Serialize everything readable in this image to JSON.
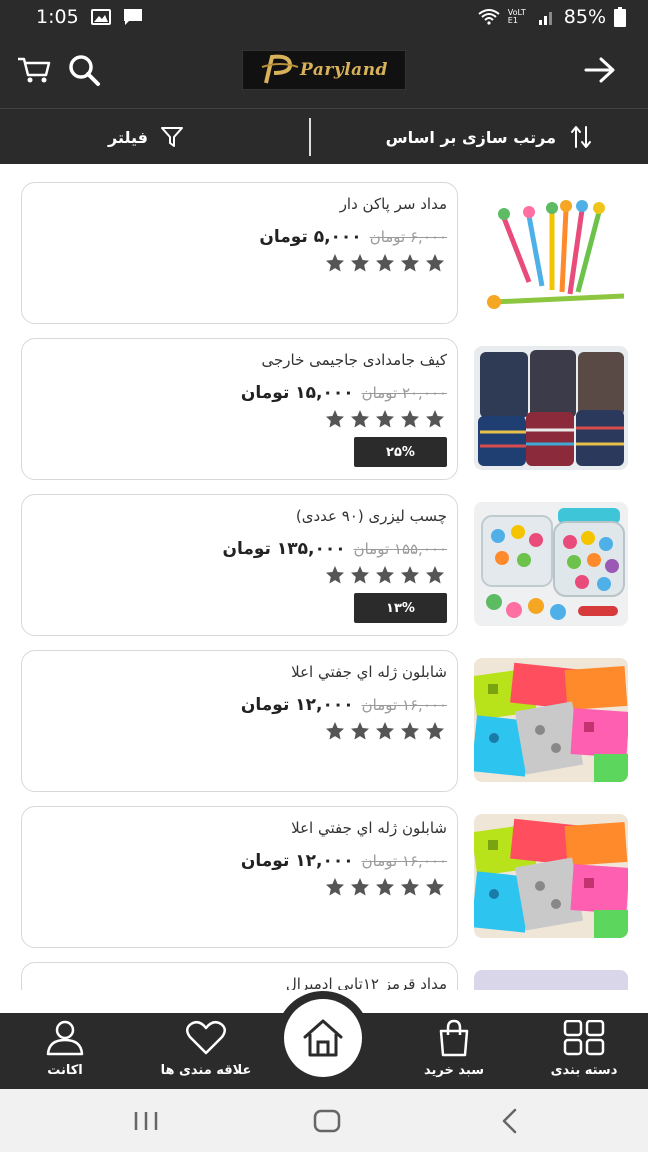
{
  "status_bar": {
    "time": "1:05",
    "network": "VoLTE1",
    "battery": "85%",
    "icons": [
      "image-icon",
      "message-icon",
      "wifi-icon",
      "signal-icon",
      "battery-icon"
    ]
  },
  "header": {
    "logo_text": "Paryland",
    "icons": [
      "cart-icon",
      "search-icon",
      "arrow-right-icon"
    ]
  },
  "toolbar": {
    "sort_label": "مرتب سازی بر اساس",
    "filter_label": "فیلتر",
    "icons": [
      "sort-icon",
      "filter-icon"
    ]
  },
  "products": [
    {
      "name": "مداد سر پاکن دار",
      "old_price": "۶,۰۰۰ تومان",
      "price": "۵,۰۰۰ تومان",
      "rating": 5,
      "discount": "",
      "image": "colorful-pencils"
    },
    {
      "name": "کیف جامدادی جاجیمی خارجی",
      "old_price": "۲۰,۰۰۰ تومان",
      "price": "۱۵,۰۰۰ تومان",
      "rating": 5,
      "discount": "۲۵%",
      "image": "fabric-pencil-cases"
    },
    {
      "name": "چسب لیزری (۹۰ عددی)",
      "old_price": "۱۵۵,۰۰۰ تومان",
      "price": "۱۳۵,۰۰۰ تومان",
      "rating": 5,
      "discount": "۱۳%",
      "image": "tape-jar"
    },
    {
      "name": "شابلون ژله اي جفتي اعلا",
      "old_price": "۱۶,۰۰۰ تومان",
      "price": "۱۲,۰۰۰ تومان",
      "rating": 5,
      "discount": "",
      "image": "stencils"
    },
    {
      "name": "شابلون ژله اي جفتي اعلا",
      "old_price": "۱۶,۰۰۰ تومان",
      "price": "۱۲,۰۰۰ تومان",
      "rating": 5,
      "discount": "",
      "image": "stencils"
    },
    {
      "name": "مداد قرمز ۱۲تایی ادمیرال",
      "old_price": "",
      "price": "",
      "rating": 0,
      "discount": "",
      "image": "partial"
    }
  ],
  "bottom_nav": {
    "categories_label": "دسته بندی",
    "cart_label": "سبد خرید",
    "favorites_label": "علاقه مندی ها",
    "account_label": "اکانت",
    "icons": [
      "grid-icon",
      "bag-icon",
      "home-icon",
      "heart-icon",
      "user-icon"
    ]
  },
  "system_nav": {
    "icons": [
      "recents-icon",
      "home-outline-icon",
      "back-chevron-icon"
    ]
  },
  "colors": {
    "dark_bar": "#2b2b2b",
    "star": "#555555",
    "old_price": "#9a9a9a",
    "logo_gold": "#d8b25a"
  }
}
